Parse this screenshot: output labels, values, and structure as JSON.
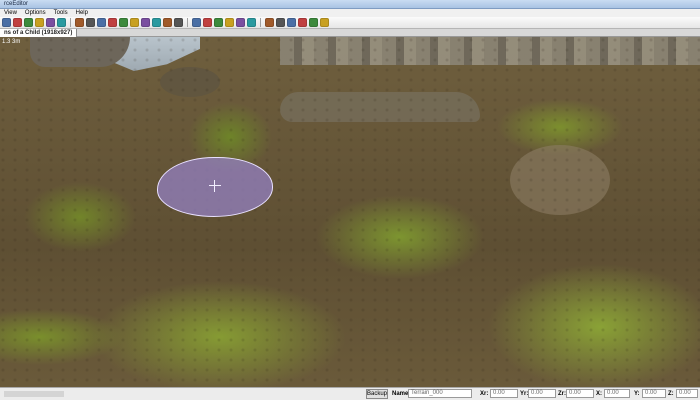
{
  "window": {
    "title": "rceEditor"
  },
  "menu": {
    "items": [
      "View",
      "Options",
      "Tools",
      "Help"
    ]
  },
  "toolbar": {
    "icons": [
      "new-icon",
      "save-icon",
      "undo-icon",
      "redo-icon",
      "refresh-icon",
      "layers-icon",
      "terrain-icon",
      "tree-icon",
      "grass-icon",
      "water-icon",
      "rock-icon",
      "road-icon",
      "light-icon",
      "camera-icon",
      "brush-icon",
      "paint-icon",
      "select-icon",
      "move-icon",
      "rotate-icon",
      "scale-icon",
      "grid-icon",
      "snap-icon",
      "figure-icon",
      "bulb-icon",
      "heart-icon",
      "mask-icon",
      "shield-icon",
      "settings-icon"
    ]
  },
  "tab": {
    "label": "ns of a Child (1918x927)"
  },
  "viewport": {
    "coords_text": "1.3  3m"
  },
  "status": {
    "button_label": "Backup",
    "name_label": "Name:",
    "name_value": "Terrain_000",
    "x_label": "Xr:",
    "x_value": "0.00",
    "y_label": "Yr:",
    "y_value": "0.00",
    "z_label": "Zr:",
    "z_value": "0.00",
    "xs_label": "X:",
    "xs_value": "0.00",
    "ys_label": "Y:",
    "ys_value": "0.00",
    "zs_label": "Z:",
    "zs_value": "0.00"
  },
  "colors": {
    "brush": "#9682c8",
    "grass": "#869b33",
    "dirt": "#6f5f3e"
  }
}
